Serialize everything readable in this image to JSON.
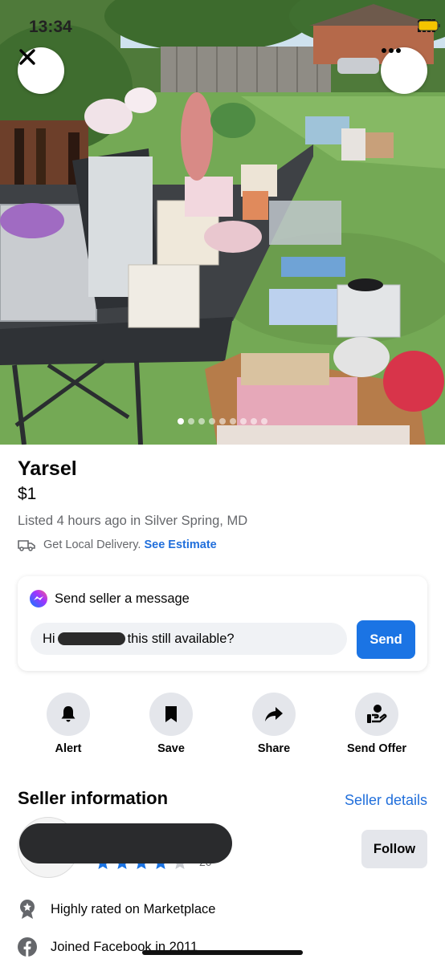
{
  "status_bar": {
    "time": "13:34"
  },
  "hero": {
    "dots_total": 9,
    "active_dot": 0,
    "photo_description_icon": "image-photo"
  },
  "listing": {
    "title": "Yarsel",
    "price": "$1",
    "listed": "Listed 4 hours ago in Silver Spring, MD",
    "delivery_text": "Get Local Delivery.",
    "delivery_link": "See Estimate"
  },
  "message": {
    "header": "Send seller a message",
    "input_prefix": "Hi",
    "input_suffix": "this still available?",
    "send_label": "Send"
  },
  "actions": [
    {
      "label": "Alert",
      "icon": "bell-icon"
    },
    {
      "label": "Save",
      "icon": "bookmark-icon"
    },
    {
      "label": "Share",
      "icon": "share-arrow-icon"
    },
    {
      "label": "Send Offer",
      "icon": "offer-hand-icon"
    }
  ],
  "seller": {
    "section_title": "Seller information",
    "details_link": "Seller details",
    "follow_label": "Follow",
    "rating_stars": 4,
    "rating_max": 5,
    "rating_count": "20",
    "badges": [
      {
        "text": "Highly rated on Marketplace",
        "icon": "award-badge-icon"
      },
      {
        "text": "Joined Facebook in 2011",
        "icon": "facebook-icon"
      }
    ]
  },
  "colors": {
    "accent": "#1b74e4",
    "link": "#216fdb",
    "secondary_text": "#65676b",
    "button_gray": "#e4e6eb"
  }
}
